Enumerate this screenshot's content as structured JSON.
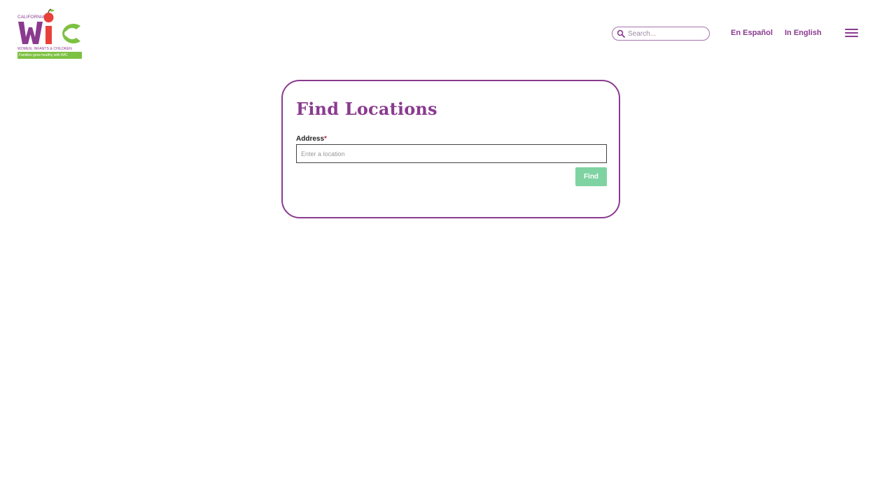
{
  "header": {
    "logo": {
      "state": "CALIFORNIA",
      "mark": "WIC",
      "subtitle": "WOMEN, INFANTS & CHILDREN",
      "tagline": "Families grow healthy with WIC"
    },
    "search": {
      "placeholder": "Search..."
    },
    "lang_es": "En Español",
    "lang_en": "In English",
    "menu_icon": "hamburger-menu-icon"
  },
  "finder": {
    "title": "Find Locations",
    "address_label": "Address",
    "required_mark": "*",
    "address_placeholder": "Enter a location",
    "find_label": "Find"
  },
  "colors": {
    "brand_purple": "#8a3b8f",
    "brand_green": "#7dc142",
    "find_button": "#7fd3a2",
    "apple_red": "#e8403a"
  }
}
